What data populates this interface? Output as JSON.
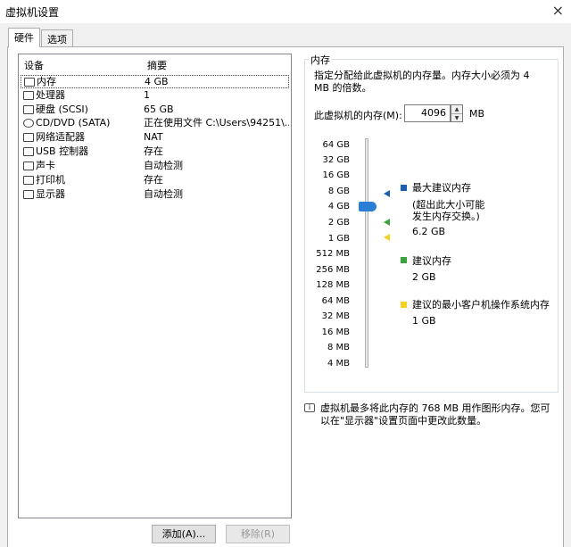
{
  "window": {
    "title": "虚拟机设置",
    "close_glyph": "×"
  },
  "tabs": [
    {
      "label": "硬件"
    },
    {
      "label": "选项"
    }
  ],
  "devices": {
    "header_device": "设备",
    "header_summary": "摘要",
    "items": [
      {
        "name": "内存",
        "summary": "4 GB",
        "icon": "memory-icon"
      },
      {
        "name": "处理器",
        "summary": "1",
        "icon": "processor-icon"
      },
      {
        "name": "硬盘 (SCSI)",
        "summary": "65 GB",
        "icon": "harddisk-icon"
      },
      {
        "name": "CD/DVD (SATA)",
        "summary": "正在使用文件 C:\\Users\\94251\\...",
        "icon": "cd-dvd-icon"
      },
      {
        "name": "网络适配器",
        "summary": "NAT",
        "icon": "network-adapter-icon"
      },
      {
        "name": "USB 控制器",
        "summary": "存在",
        "icon": "usb-controller-icon"
      },
      {
        "name": "声卡",
        "summary": "自动检测",
        "icon": "sound-card-icon"
      },
      {
        "name": "打印机",
        "summary": "存在",
        "icon": "printer-icon"
      },
      {
        "name": "显示器",
        "summary": "自动检测",
        "icon": "display-icon"
      }
    ],
    "add_button": "添加(A)...",
    "remove_button": "移除(R)"
  },
  "memory": {
    "group_title": "内存",
    "description": "指定分配给此虚拟机的内存量。内存大小必须为 4 MB 的倍数。",
    "field_label": "此虚拟机的内存(M):",
    "value": "4096",
    "unit": "MB",
    "slider_ticks": [
      "64 GB",
      "32 GB",
      "16 GB",
      "8 GB",
      "4 GB",
      "2 GB",
      "1 GB",
      "512 MB",
      "256 MB",
      "128 MB",
      "64 MB",
      "32 MB",
      "16 MB",
      "8 MB",
      "4 MB"
    ],
    "slider_selected": "4 GB",
    "legend": {
      "max": {
        "title": "最大建议内存",
        "note_line1": "(超出此大小可能",
        "note_line2": "发生内存交换。)",
        "value": "6.2 GB",
        "color": "#1a5fb4"
      },
      "recommended": {
        "title": "建议内存",
        "value": "2 GB",
        "color": "#3aa53a"
      },
      "min": {
        "title": "建议的最小客户机操作系统内存",
        "value": "1 GB",
        "color": "#f4d21f"
      }
    }
  },
  "info": {
    "text": "虚拟机最多将此内存的 768 MB 用作图形内存。您可以在\"显示器\"设置页面中更改此数量。"
  }
}
